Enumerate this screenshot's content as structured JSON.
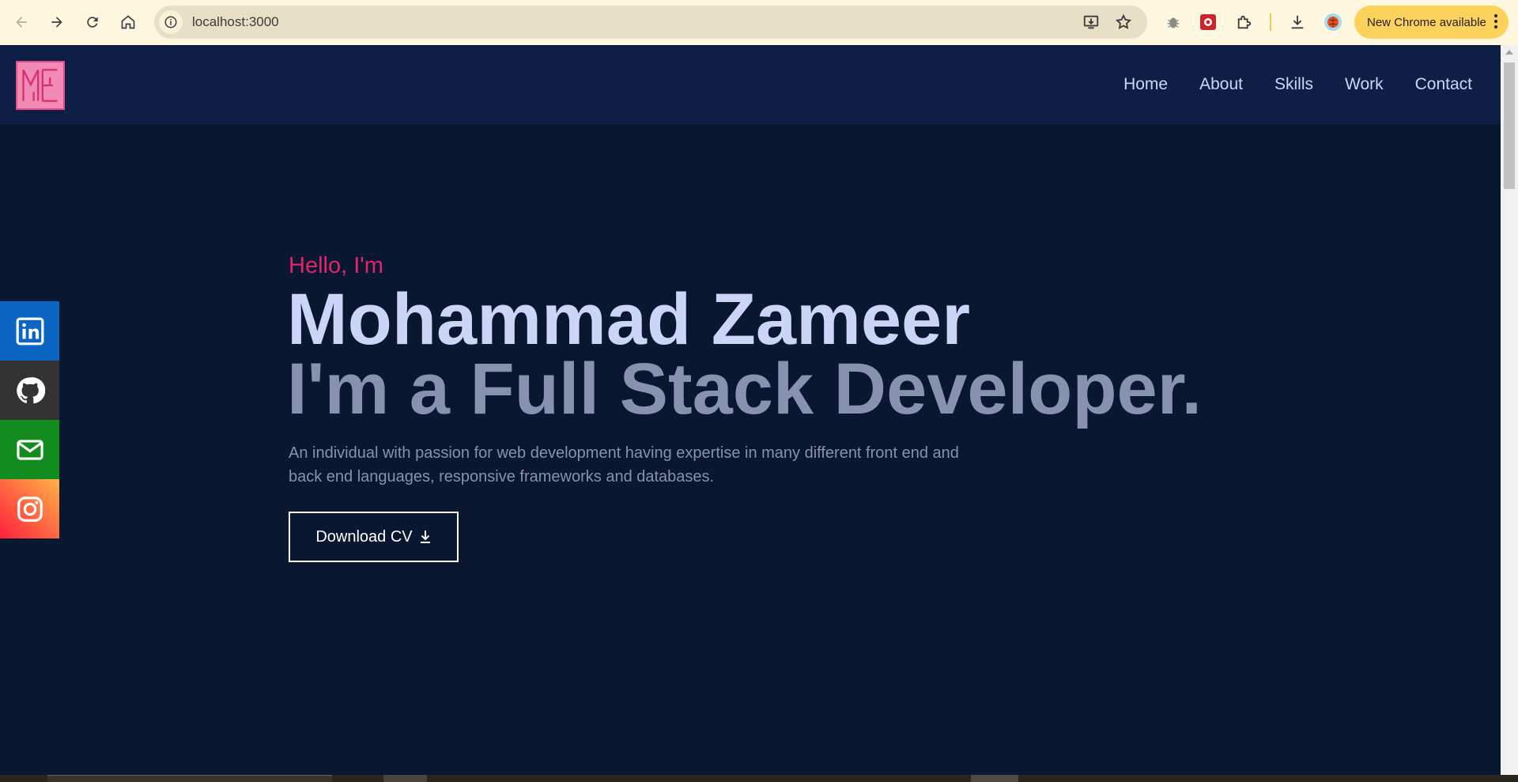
{
  "browser": {
    "url": "localhost:3000",
    "update_label": "New Chrome available"
  },
  "nav": {
    "items": [
      "Home",
      "About",
      "Skills",
      "Work",
      "Contact"
    ]
  },
  "hero": {
    "greeting": "Hello, I'm",
    "name": "Mohammad Zameer",
    "role": "I'm a Full Stack Developer.",
    "bio": "An individual with passion for web development having expertise in many different front end and back end languages, responsive frameworks and databases.",
    "cv_label": "Download CV"
  },
  "social": [
    {
      "icon": "linkedin-icon",
      "color": "#0a66c2"
    },
    {
      "icon": "github-icon",
      "color": "#333333"
    },
    {
      "icon": "mail-icon",
      "color": "#128c1e"
    },
    {
      "icon": "instagram-icon",
      "color": "#f56040"
    }
  ],
  "colors": {
    "accent": "#e2246f",
    "background": "#0a192f",
    "header": "#0d1f44"
  }
}
